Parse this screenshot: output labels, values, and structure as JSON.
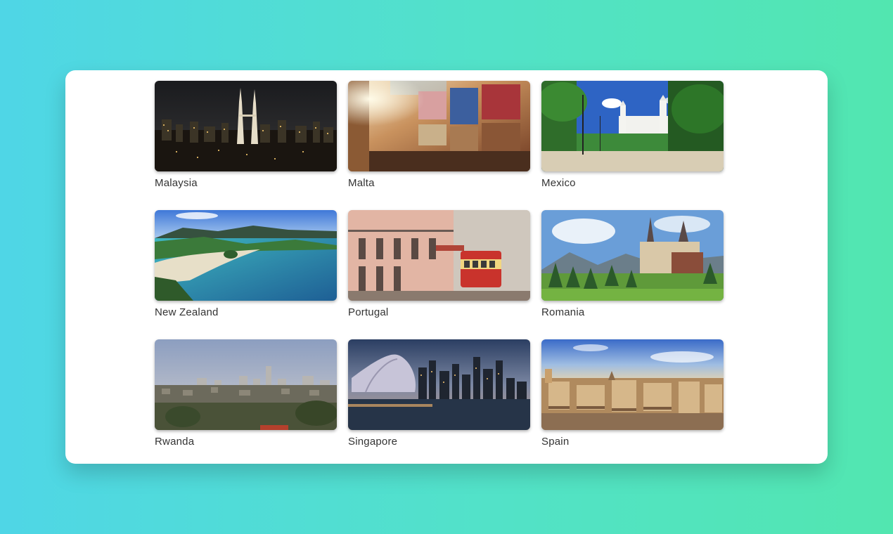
{
  "gallery": {
    "items": [
      {
        "label": "Malaysia",
        "scene": "city-night"
      },
      {
        "label": "Malta",
        "scene": "street-balconies"
      },
      {
        "label": "Mexico",
        "scene": "plaza-church"
      },
      {
        "label": "New Zealand",
        "scene": "coastal-bay"
      },
      {
        "label": "Portugal",
        "scene": "tram-street"
      },
      {
        "label": "Romania",
        "scene": "castle-forest"
      },
      {
        "label": "Rwanda",
        "scene": "hillside-city"
      },
      {
        "label": "Singapore",
        "scene": "waterfront-skyline"
      },
      {
        "label": "Spain",
        "scene": "rooftop-panorama"
      }
    ]
  }
}
